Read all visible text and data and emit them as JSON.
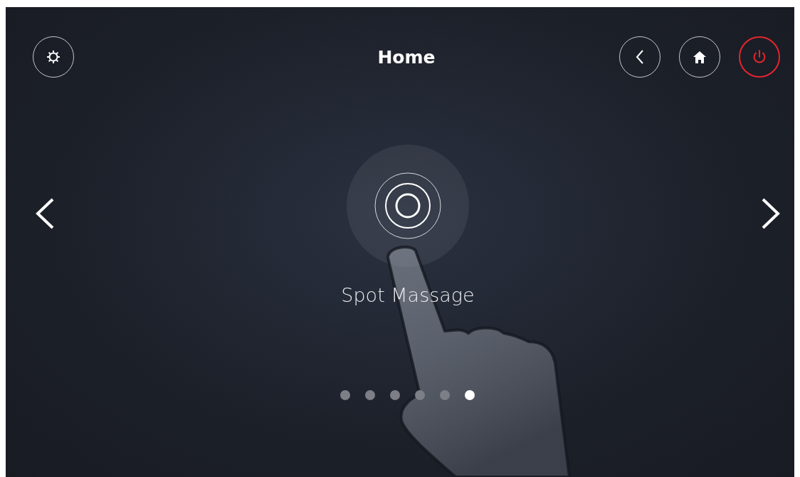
{
  "header": {
    "title": "Home"
  },
  "mode": {
    "label": "Spot Massage"
  },
  "page_dots": [
    {
      "selected": false
    },
    {
      "selected": false
    },
    {
      "selected": false
    },
    {
      "selected": false
    },
    {
      "selected": false
    },
    {
      "selected": true
    }
  ]
}
